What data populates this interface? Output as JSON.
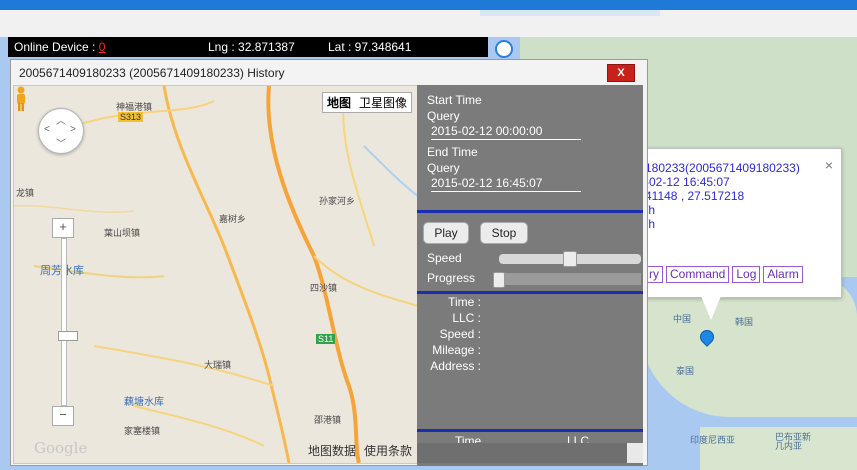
{
  "status_bar": {
    "online_label": "Online Device : ",
    "online_count": "0",
    "lng": "Lng : 32.871387",
    "lat": "Lat : 97.348641"
  },
  "dialog": {
    "title": "2005671409180233 (2005671409180233) History",
    "close_label": "X"
  },
  "map": {
    "type_buttons": [
      "地图",
      "卫星图像"
    ],
    "footer": [
      "地图数据",
      "使用条款"
    ],
    "logo": "Google",
    "places": [
      "神福港镇",
      "S313",
      "龙镇",
      "周芳水库",
      "葉山坝镇",
      "孙家河乡",
      "嘉树乡",
      "四沙镇",
      "S11",
      "大瑞镇",
      "藕塘水库",
      "家塞楼镇",
      "邵港镇"
    ]
  },
  "panel": {
    "start_time_label": "Start Time",
    "start_query_label": "Query",
    "start_time_value": "2015-02-12 00:00:00",
    "end_time_label": "End Time",
    "end_query_label": "Query",
    "end_time_value": "2015-02-12 16:45:07",
    "play_label": "Play",
    "stop_label": "Stop",
    "speed_label": "Speed",
    "progress_label": "Progress",
    "speed_slider_level": 0.5,
    "progress_level": 0,
    "info_labels": [
      "Time :",
      "LLC :",
      "Speed :",
      "Mileage :",
      "Address :"
    ],
    "table_headers": [
      "Time",
      "LLC"
    ]
  },
  "popup": {
    "line1": "180233(2005671409180233)",
    "line2": "-02-12 16:45:07",
    "line3": "41148 , 27.517218",
    "line4": "/h",
    "line5": "/h",
    "links": [
      "ry",
      "Command",
      "Log",
      "Alarm"
    ],
    "close": "×"
  },
  "world_map": {
    "labels": [
      "中国",
      "韩国",
      "泰国",
      "印度尼西亚",
      "巴布亚新几内亚"
    ]
  }
}
